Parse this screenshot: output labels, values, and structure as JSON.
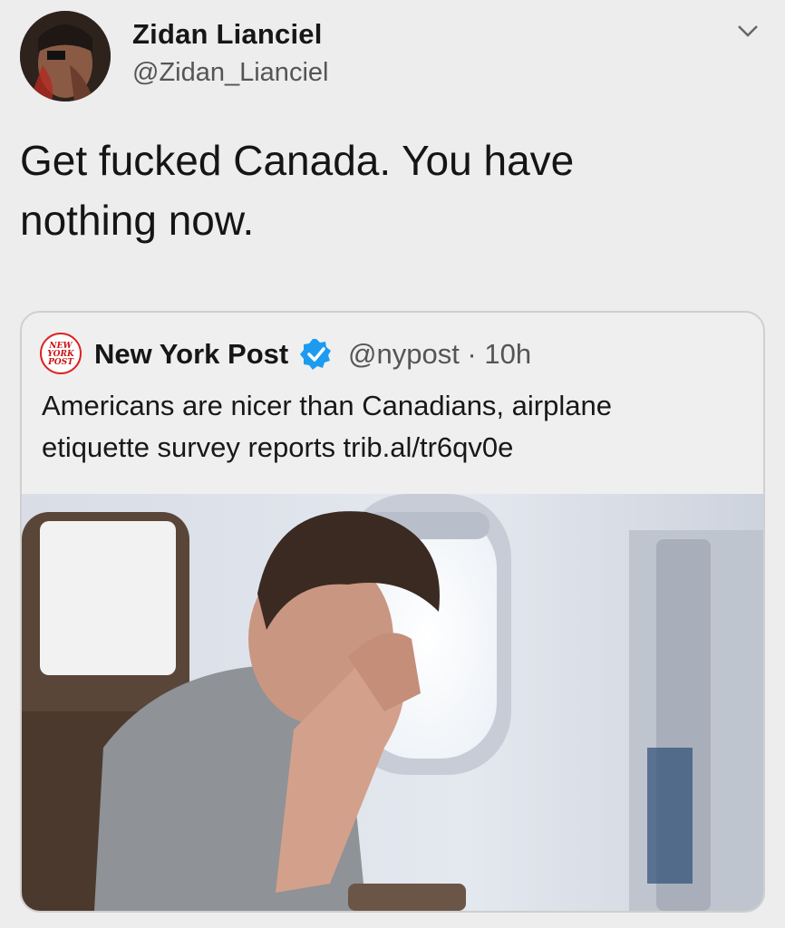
{
  "tweet": {
    "author_name": "Zidan Lianciel",
    "author_handle": "@Zidan_Lianciel",
    "text_line1": "Get fucked Canada. You have",
    "text_line2": "nothing now.",
    "avatar_icon": "user-avatar",
    "menu_icon": "chevron-down-icon"
  },
  "quoted_tweet": {
    "source_name": "New York Post",
    "logo_text": [
      "NEW",
      "YORK",
      "POST"
    ],
    "verified_icon": "verified-badge-icon",
    "handle_time": "@nypost · 10h",
    "text_line1": "Americans are nicer than Canadians, airplane",
    "text_line2": "etiquette survey reports trib.al/tr6qv0e",
    "image_description_icon": "photo-man-on-airplane"
  },
  "colors": {
    "background": "#ededed",
    "verified_blue": "#1d9bf0",
    "nypost_red": "#cc1111",
    "text_primary": "#151515",
    "text_secondary": "#555555"
  }
}
